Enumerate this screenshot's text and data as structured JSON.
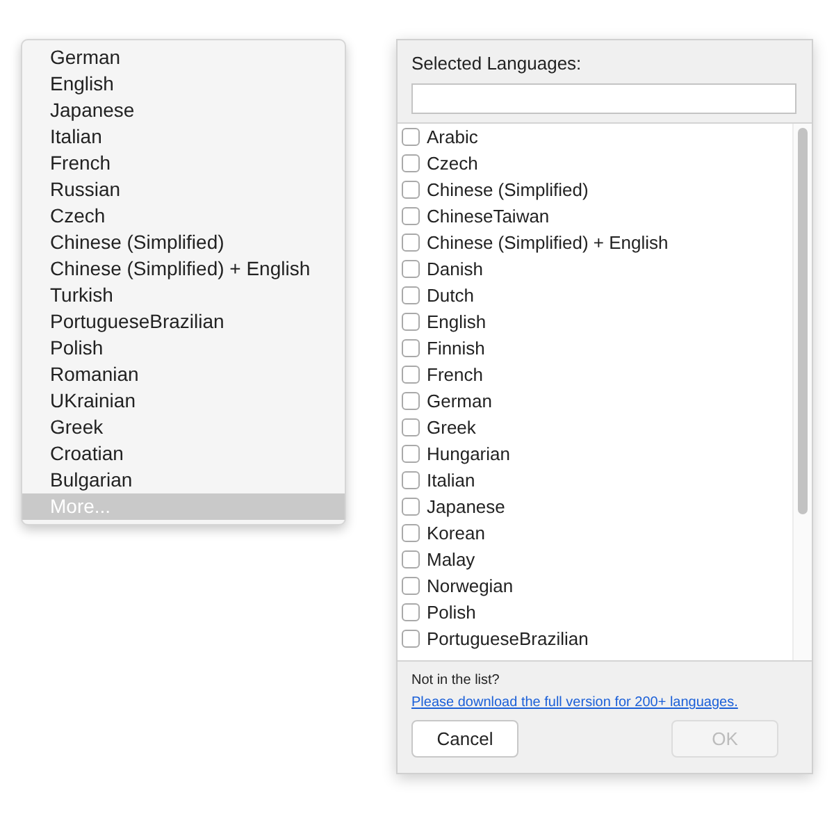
{
  "menu": {
    "items": [
      {
        "label": "German",
        "highlighted": false
      },
      {
        "label": "English",
        "highlighted": false
      },
      {
        "label": "Japanese",
        "highlighted": false
      },
      {
        "label": "Italian",
        "highlighted": false
      },
      {
        "label": "French",
        "highlighted": false
      },
      {
        "label": "Russian",
        "highlighted": false
      },
      {
        "label": "Czech",
        "highlighted": false
      },
      {
        "label": "Chinese (Simplified)",
        "highlighted": false
      },
      {
        "label": "Chinese (Simplified) + English",
        "highlighted": false
      },
      {
        "label": "Turkish",
        "highlighted": false
      },
      {
        "label": "PortugueseBrazilian",
        "highlighted": false
      },
      {
        "label": "Polish",
        "highlighted": false
      },
      {
        "label": "Romanian",
        "highlighted": false
      },
      {
        "label": "UKrainian",
        "highlighted": false
      },
      {
        "label": "Greek",
        "highlighted": false
      },
      {
        "label": "Croatian",
        "highlighted": false
      },
      {
        "label": "Bulgarian",
        "highlighted": false
      },
      {
        "label": "More...",
        "highlighted": true
      }
    ]
  },
  "dialog": {
    "title": "Selected Languages:",
    "languages": [
      {
        "label": "Arabic",
        "checked": false
      },
      {
        "label": "Czech",
        "checked": false
      },
      {
        "label": "Chinese (Simplified)",
        "checked": false
      },
      {
        "label": "ChineseTaiwan",
        "checked": false
      },
      {
        "label": "Chinese (Simplified) + English",
        "checked": false
      },
      {
        "label": "Danish",
        "checked": false
      },
      {
        "label": "Dutch",
        "checked": false
      },
      {
        "label": "English",
        "checked": false
      },
      {
        "label": "Finnish",
        "checked": false
      },
      {
        "label": "French",
        "checked": false
      },
      {
        "label": "German",
        "checked": false
      },
      {
        "label": "Greek",
        "checked": false
      },
      {
        "label": "Hungarian",
        "checked": false
      },
      {
        "label": "Italian",
        "checked": false
      },
      {
        "label": "Japanese",
        "checked": false
      },
      {
        "label": "Korean",
        "checked": false
      },
      {
        "label": "Malay",
        "checked": false
      },
      {
        "label": "Norwegian",
        "checked": false
      },
      {
        "label": "Polish",
        "checked": false
      },
      {
        "label": "PortugueseBrazilian",
        "checked": false
      }
    ],
    "note": "Not in the list?",
    "link": "Please download the full version for 200+ languages.",
    "buttons": [
      {
        "label": "Cancel",
        "disabled": false
      },
      {
        "label": "OK",
        "disabled": true
      }
    ]
  }
}
